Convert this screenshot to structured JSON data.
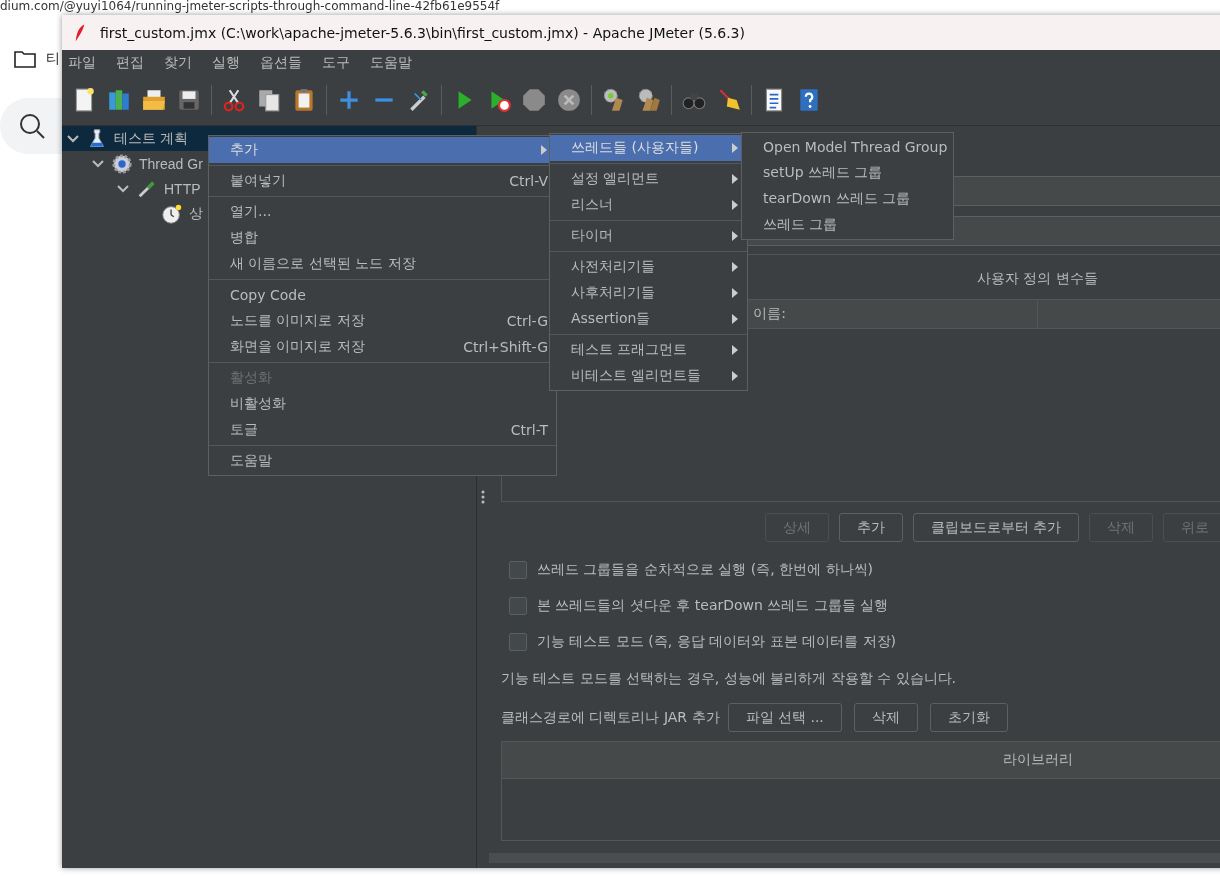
{
  "browser": {
    "url": "dium.com/@yuyi1064/running-jmeter-scripts-through-command-line-42fb61e9554f",
    "bookmark": "티"
  },
  "window": {
    "title": "first_custom.jmx (C:\\work\\apache-jmeter-5.6.3\\bin\\first_custom.jmx) - Apache JMeter (5.6.3)"
  },
  "menu_bar": [
    "파일",
    "편집",
    "찾기",
    "실행",
    "옵션들",
    "도구",
    "도움말"
  ],
  "tree": [
    {
      "label": "테스트 계획",
      "kind": "plan",
      "selected": true,
      "expanded": true,
      "children": [
        {
          "label": "Thread Gr",
          "kind": "thread_group",
          "selected": false,
          "expanded": true,
          "children": [
            {
              "label": "HTTP",
              "kind": "sampler",
              "selected": false,
              "expanded": true,
              "children": [
                {
                  "label": "상",
                  "kind": "timer",
                  "selected": false
                }
              ]
            }
          ]
        }
      ]
    }
  ],
  "context_menu": {
    "groups": [
      [
        {
          "label": "추가",
          "has_submenu": true,
          "selected": true,
          "disabled": false
        }
      ],
      [
        {
          "label": "붙여넣기",
          "shortcut": "Ctrl-V",
          "has_submenu": false,
          "selected": false,
          "disabled": false
        }
      ],
      [
        {
          "label": "열기...",
          "has_submenu": false,
          "selected": false,
          "disabled": false
        },
        {
          "label": "병합",
          "has_submenu": false,
          "selected": false,
          "disabled": false
        },
        {
          "label": "새 이름으로 선택된 노드 저장",
          "has_submenu": false,
          "selected": false,
          "disabled": false
        }
      ],
      [
        {
          "label": "Copy Code",
          "has_submenu": false,
          "selected": false,
          "disabled": false
        },
        {
          "label": "노드를 이미지로 저장",
          "shortcut": "Ctrl-G",
          "has_submenu": false,
          "selected": false,
          "disabled": false
        },
        {
          "label": "화면을 이미지로 저장",
          "shortcut": "Ctrl+Shift-G",
          "has_submenu": false,
          "selected": false,
          "disabled": false
        }
      ],
      [
        {
          "label": "활성화",
          "has_submenu": false,
          "selected": false,
          "disabled": true
        },
        {
          "label": "비활성화",
          "has_submenu": false,
          "selected": false,
          "disabled": false
        },
        {
          "label": "토글",
          "shortcut": "Ctrl-T",
          "has_submenu": false,
          "selected": false,
          "disabled": false
        }
      ],
      [
        {
          "label": "도움말",
          "has_submenu": false,
          "selected": false,
          "disabled": false
        }
      ]
    ]
  },
  "add_submenu": {
    "groups": [
      [
        {
          "label": "쓰레드들 (사용자들)",
          "has_submenu": true,
          "selected": true,
          "disabled": false
        }
      ],
      [
        {
          "label": "설정 엘리먼트",
          "has_submenu": true,
          "selected": false,
          "disabled": false
        },
        {
          "label": "리스너",
          "has_submenu": true,
          "selected": false,
          "disabled": false
        }
      ],
      [
        {
          "label": "타이머",
          "has_submenu": true,
          "selected": false,
          "disabled": false
        }
      ],
      [
        {
          "label": "사전처리기들",
          "has_submenu": true,
          "selected": false,
          "disabled": false
        },
        {
          "label": "사후처리기들",
          "has_submenu": true,
          "selected": false,
          "disabled": false
        },
        {
          "label": "Assertion들",
          "has_submenu": true,
          "selected": false,
          "disabled": false
        }
      ],
      [
        {
          "label": "테스트 프래그먼트",
          "has_submenu": true,
          "selected": false,
          "disabled": false
        },
        {
          "label": "비테스트 엘리먼트들",
          "has_submenu": true,
          "selected": false,
          "disabled": false
        }
      ]
    ]
  },
  "threads_submenu": {
    "groups": [
      [
        {
          "label": "Open Model Thread Group",
          "has_submenu": false,
          "selected": false,
          "disabled": false
        },
        {
          "label": "setUp 쓰레드 그룹",
          "has_submenu": false,
          "selected": false,
          "disabled": false
        },
        {
          "label": "tearDown 쓰레드 그룹",
          "has_submenu": false,
          "selected": false,
          "disabled": false
        },
        {
          "label": "쓰레드 그룹",
          "has_submenu": false,
          "selected": false,
          "disabled": false
        }
      ]
    ]
  },
  "variables": {
    "title": "사용자 정의 변수들",
    "columns": [
      "이름:"
    ]
  },
  "buttons": [
    {
      "label": "상세",
      "disabled": true
    },
    {
      "label": "추가",
      "disabled": false
    },
    {
      "label": "클립보드로부터 추가",
      "disabled": false
    },
    {
      "label": "삭제",
      "disabled": true
    },
    {
      "label": "위로",
      "disabled": true
    }
  ],
  "options": [
    {
      "label": "쓰레드 그룹들을 순차적으로 실행 (즉, 한번에 하나씩)",
      "checked": false
    },
    {
      "label": "본 쓰레드들의 셧다운 후 tearDown 쓰레드 그룹들 실행",
      "checked": false
    },
    {
      "label": "기능 테스트 모드 (즉, 응답 데이터와 표본 데이터를 저장)",
      "checked": false
    }
  ],
  "note": "기능 테스트 모드를 선택하는 경우, 성능에 불리하게 작용할 수 있습니다.",
  "classpath": {
    "label": "클래스경로에 디렉토리나 JAR 추가",
    "buttons": [
      "파일 선택 ...",
      "삭제",
      "초기화"
    ]
  },
  "library_table": {
    "columns": [
      "라이브러리"
    ]
  }
}
